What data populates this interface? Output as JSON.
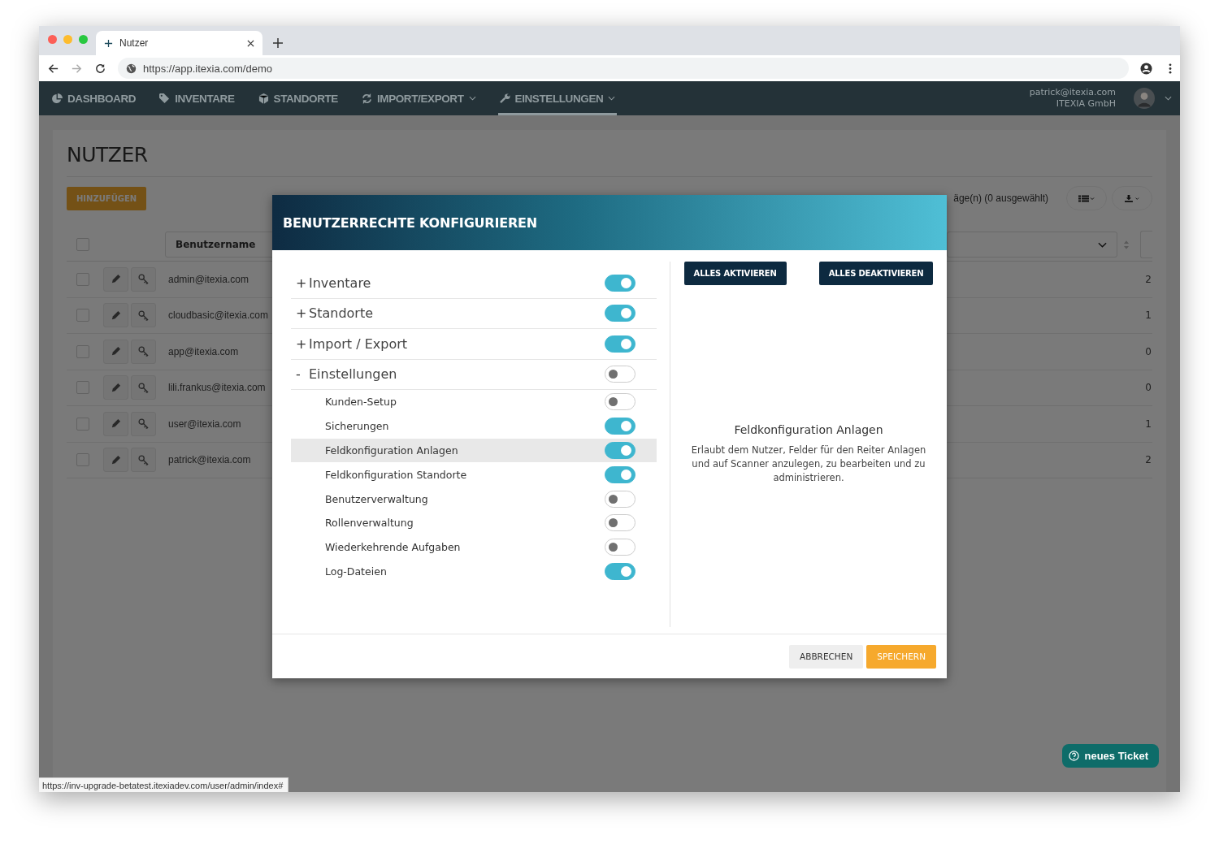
{
  "browser": {
    "tab_title": "Nutzer",
    "url": "https://app.itexia.com/demo",
    "status_url": "https://inv-upgrade-betatest.itexiadev.com/user/admin/index#"
  },
  "nav": {
    "items": [
      {
        "label": "DASHBOARD",
        "dropdown": false,
        "selected": false
      },
      {
        "label": "INVENTARE",
        "dropdown": false,
        "selected": false
      },
      {
        "label": "STANDORTE",
        "dropdown": false,
        "selected": false
      },
      {
        "label": "IMPORT/EXPORT",
        "dropdown": true,
        "selected": false
      },
      {
        "label": "EINSTELLUNGEN",
        "dropdown": true,
        "selected": true
      }
    ],
    "user": {
      "email": "patrick@itexia.com",
      "company": "ITEXIA GmbH"
    }
  },
  "page": {
    "title": "NUTZER",
    "add_button": "HINZUFÜGEN",
    "records_info": "äge(n) (0 ausgewählt)",
    "table": {
      "header_checked": false,
      "column_header": "Benutzername",
      "rows": [
        {
          "checked": false,
          "username": "admin@itexia.com",
          "column_3": "2"
        },
        {
          "checked": false,
          "username": "cloudbasic@itexia.com",
          "column_3": "1"
        },
        {
          "checked": false,
          "username": "app@itexia.com",
          "column_3": "0"
        },
        {
          "checked": false,
          "username": "lili.frankus@itexia.com",
          "column_3": "0"
        },
        {
          "checked": false,
          "username": "user@itexia.com",
          "column_3": "1"
        },
        {
          "checked": false,
          "username": "patrick@itexia.com",
          "column_3": "2"
        }
      ]
    }
  },
  "modal": {
    "title": "BENUTZERRECHTE KONFIGURIEREN",
    "permissions": [
      {
        "marker": "+",
        "label": "Inventare",
        "on": true
      },
      {
        "marker": "+",
        "label": "Standorte",
        "on": true
      },
      {
        "marker": "+",
        "label": "Import / Export",
        "on": true
      },
      {
        "marker": "-",
        "label": "Einstellungen",
        "on": false,
        "children": [
          {
            "label": "Kunden-Setup",
            "on": false,
            "selected": false
          },
          {
            "label": "Sicherungen",
            "on": true,
            "selected": false
          },
          {
            "label": "Feldkonfiguration Anlagen",
            "on": true,
            "selected": true
          },
          {
            "label": "Feldkonfiguration Standorte",
            "on": true,
            "selected": false
          },
          {
            "label": "Benutzerverwaltung",
            "on": false,
            "selected": false
          },
          {
            "label": "Rollenverwaltung",
            "on": false,
            "selected": false
          },
          {
            "label": "Wiederkehrende Aufgaben",
            "on": false,
            "selected": false
          },
          {
            "label": "Log-Dateien",
            "on": true,
            "selected": false
          }
        ]
      }
    ],
    "activate_all": "ALLES AKTIVIEREN",
    "deactivate_all": "ALLES DEAKTIVIEREN",
    "detail": {
      "title": "Feldkonfiguration Anlagen",
      "description": "Erlaubt dem Nutzer, Felder für den Reiter Anlagen und auf Scanner anzulegen, zu bearbeiten und zu administrieren."
    },
    "cancel": "ABBRECHEN",
    "save": "SPEICHERN"
  },
  "help_button": "neues Ticket"
}
